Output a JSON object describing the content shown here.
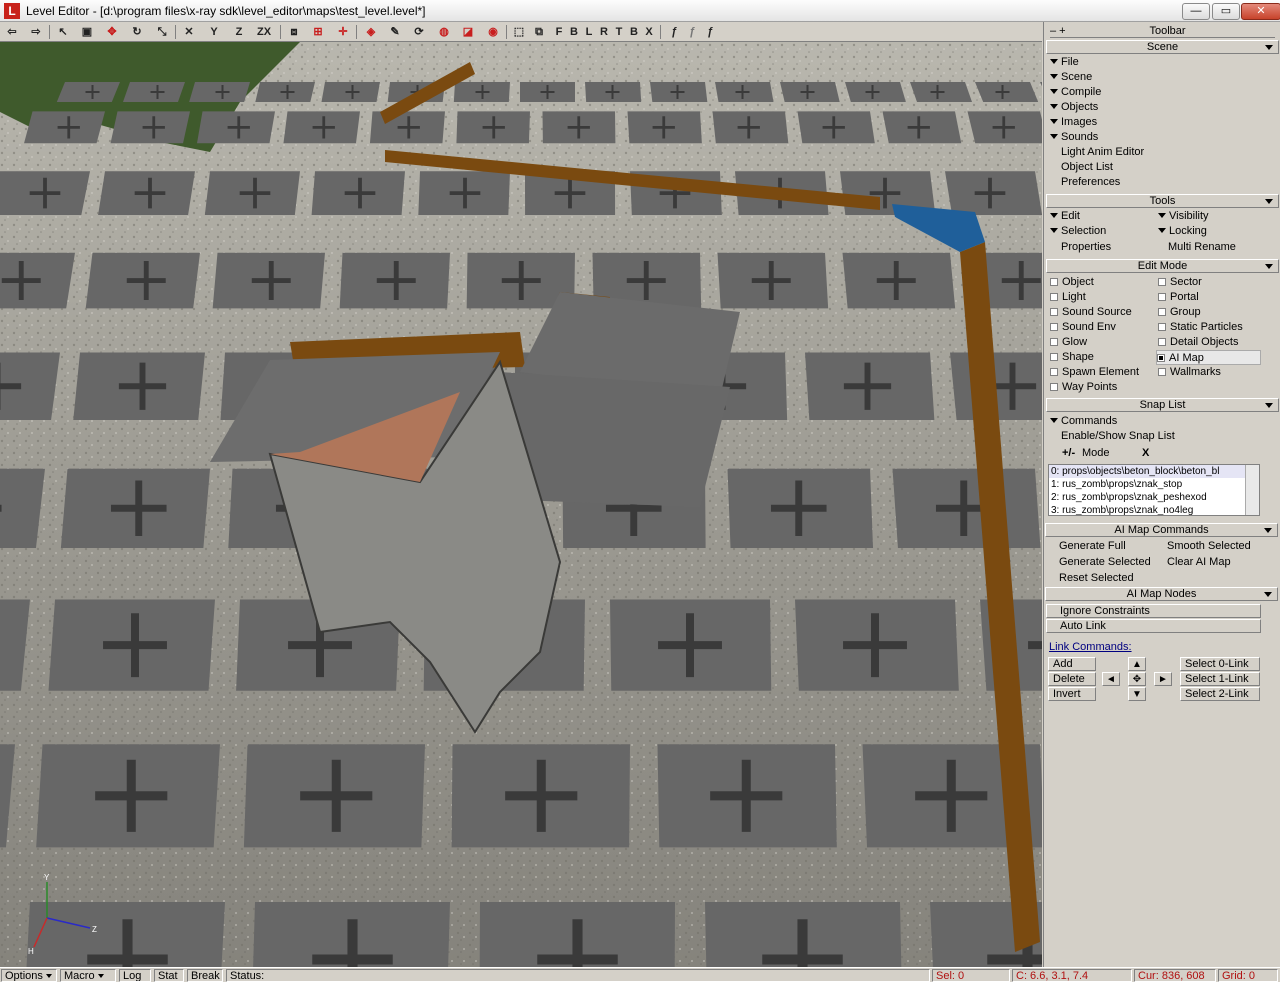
{
  "window": {
    "title": "Level Editor - [d:\\program files\\x-ray sdk\\level_editor\\maps\\test_level.level*]",
    "app_icon_letter": "L",
    "minimize": "—",
    "maximize": "▭",
    "close": "✕"
  },
  "toolbar": {
    "icons": [
      "undo-icon",
      "redo-icon",
      "select-icon",
      "camera-icon",
      "move-icon",
      "rotate-icon",
      "scale-icon",
      "lock-x-icon",
      "lock-y-icon",
      "lock-z-icon",
      "lock-zx-icon",
      "mirror-icon",
      "snap-grid-icon",
      "snap-point-icon",
      "snap-object-icon",
      "snap-vertex-icon",
      "snap-normal-icon",
      "snap-moving-icon",
      "snap-rotate-icon",
      "snap-scale-icon",
      "zoom-extents-icon",
      "zoom-selected-icon",
      "view-front-icon",
      "view-left-icon",
      "view-back-icon",
      "view-right-icon",
      "view-top-icon",
      "view-bottom-icon",
      "view-axis-x-icon",
      "view-user-icon",
      "view-camera-icon"
    ],
    "axis_x": "X",
    "axis_y": "Y",
    "axis_z": "Z",
    "axis_zx": "ZX",
    "views": [
      "F",
      "B",
      "L",
      "R",
      "T",
      "B",
      "X"
    ]
  },
  "panel": {
    "title_bar": "Toolbar",
    "collapse": "– +",
    "scene": {
      "header": "Scene",
      "items": [
        "File",
        "Scene",
        "Compile",
        "Objects",
        "Images",
        "Sounds"
      ],
      "plain": [
        "Light Anim Editor",
        "Object List",
        "Preferences"
      ]
    },
    "tools": {
      "header": "Tools",
      "edit": "Edit",
      "visibility": "Visibility",
      "selection": "Selection",
      "locking": "Locking",
      "properties": "Properties",
      "multi_rename": "Multi Rename"
    },
    "edit_mode": {
      "header": "Edit Mode",
      "left": [
        "Object",
        "Light",
        "Sound Source",
        "Sound Env",
        "Glow",
        "Shape",
        "Spawn Element",
        "Way Points"
      ],
      "right": [
        "Sector",
        "Portal",
        "Group",
        "Static Particles",
        "Detail Objects",
        "AI Map",
        "Wallmarks"
      ],
      "active": "AI Map"
    },
    "snap_list": {
      "header": "Snap List",
      "commands": "Commands",
      "enable_show": "Enable/Show Snap List",
      "mode_label": "Mode",
      "mode_plusminus": "+/-",
      "mode_x": "X",
      "items": [
        "0: props\\objects\\beton_block\\beton_bl",
        "1: rus_zomb\\props\\znak_stop",
        "2: rus_zomb\\props\\znak_peshexod",
        "3: rus_zomb\\props\\znak_no4leg"
      ]
    },
    "ai_map_commands": {
      "header": "AI Map Commands",
      "generate_full": "Generate Full",
      "smooth_selected": "Smooth Selected",
      "generate_selected": "Generate Selected",
      "clear_ai_map": "Clear AI Map",
      "reset_selected": "Reset Selected"
    },
    "ai_map_nodes": {
      "header": "AI Map Nodes",
      "ignore_constraints": "Ignore Constraints",
      "auto_link": "Auto Link",
      "link_commands": "Link Commands:",
      "add": "Add",
      "delete": "Delete",
      "invert": "Invert",
      "select0": "Select 0-Link",
      "select1": "Select 1-Link",
      "select2": "Select 2-Link"
    }
  },
  "statusbar": {
    "options": "Options",
    "macro": "Macro",
    "log": "Log",
    "stat": "Stat",
    "break": "Break",
    "status": "Status:",
    "sel": "Sel: 0",
    "coords": "C: 6.6, 3.1, 7.4",
    "cursor": "Cur: 836, 608",
    "grid": "Grid: 0"
  },
  "viewport": {
    "axis_y": "Y",
    "axis_z": "Z",
    "axis_h": "H"
  },
  "colors": {
    "ai_node": "#676767",
    "ai_arrow": "#3a3a3a",
    "link_edge": "#7a4a10",
    "selected_edge": "#1f5f9a",
    "ground": "#8b8b86"
  }
}
